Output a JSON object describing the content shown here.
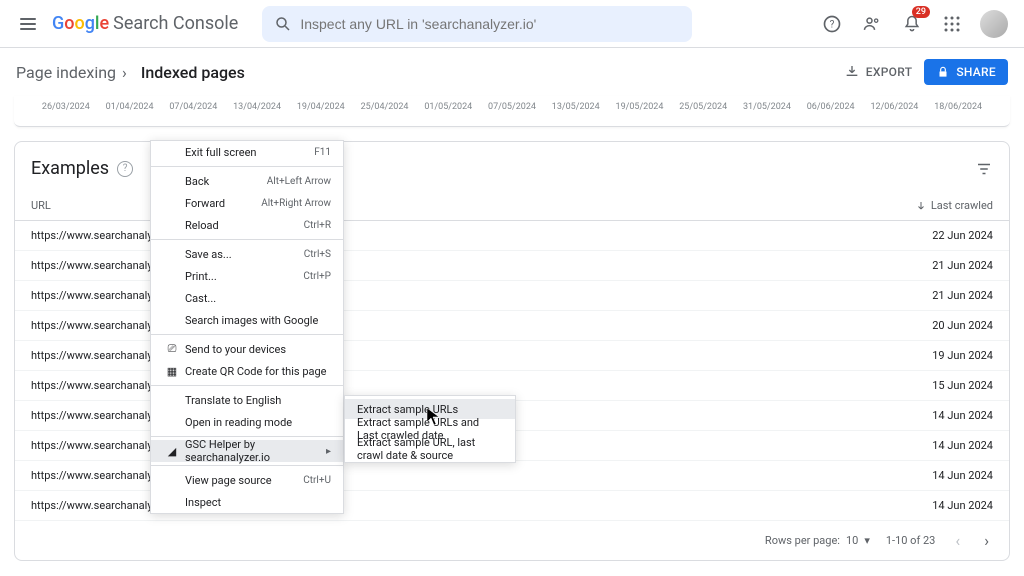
{
  "header": {
    "logo_text": "Search Console",
    "search_placeholder": "Inspect any URL in 'searchanalyzer.io'",
    "notification_count": "29"
  },
  "breadcrumb": {
    "parent": "Page indexing",
    "current": "Indexed pages"
  },
  "actions": {
    "export": "EXPORT",
    "share": "SHARE"
  },
  "dates": [
    "26/03/2024",
    "01/04/2024",
    "07/04/2024",
    "13/04/2024",
    "19/04/2024",
    "25/04/2024",
    "01/05/2024",
    "07/05/2024",
    "13/05/2024",
    "19/05/2024",
    "25/05/2024",
    "31/05/2024",
    "06/06/2024",
    "12/06/2024",
    "18/06/2024"
  ],
  "card": {
    "title": "Examples",
    "col_url": "URL",
    "col_date": "Last crawled"
  },
  "rows": [
    {
      "url": "https://www.searchanalyzer.io/",
      "date": "22 Jun 2024"
    },
    {
      "url": "https://www.searchanalyzer.io/se",
      "date": "21 Jun 2024"
    },
    {
      "url": "https://www.searchanalyzer.io/g",
      "date": "21 Jun 2024"
    },
    {
      "url": "https://www.searchanalyzer.io/w                                                                        ierung-von-seiten",
      "date": "20 Jun 2024"
    },
    {
      "url": "https://www.searchanalyzer.io/fe",
      "date": "19 Jun 2024"
    },
    {
      "url": "https://www.searchanalyzer.io/fe",
      "date": "15 Jun 2024"
    },
    {
      "url": "https://www.searchanalyzer.io/in",
      "date": "14 Jun 2024"
    },
    {
      "url": "https://www.searchanalyzer.io/tu",
      "date": "14 Jun 2024"
    },
    {
      "url": "https://www.searchanalyzer.io/features/content-optimierung",
      "date": "14 Jun 2024"
    },
    {
      "url": "https://www.searchanalyzer.io/features/optimization-wizard",
      "date": "14 Jun 2024"
    }
  ],
  "pagination": {
    "rows_label": "Rows per page:",
    "rows_value": "10",
    "range": "1-10 of 23"
  },
  "context_menu": {
    "items": [
      {
        "label": "Exit full screen",
        "shortcut": "F11"
      },
      {
        "divider": true
      },
      {
        "label": "Back",
        "shortcut": "Alt+Left Arrow"
      },
      {
        "label": "Forward",
        "shortcut": "Alt+Right Arrow"
      },
      {
        "label": "Reload",
        "shortcut": "Ctrl+R"
      },
      {
        "divider": true
      },
      {
        "label": "Save as...",
        "shortcut": "Ctrl+S"
      },
      {
        "label": "Print...",
        "shortcut": "Ctrl+P"
      },
      {
        "label": "Cast..."
      },
      {
        "label": "Search images with Google"
      },
      {
        "divider": true
      },
      {
        "label": "Send to your devices",
        "icon": "devices"
      },
      {
        "label": "Create QR Code for this page",
        "icon": "qr"
      },
      {
        "divider": true
      },
      {
        "label": "Translate to English"
      },
      {
        "label": "Open in reading mode"
      },
      {
        "divider": true
      },
      {
        "label": "GSC Helper by searchanalyzer.io",
        "icon": "ext",
        "submenu": true,
        "highlighted": true
      },
      {
        "divider": true
      },
      {
        "label": "View page source",
        "shortcut": "Ctrl+U"
      },
      {
        "label": "Inspect"
      }
    ]
  },
  "submenu": {
    "items": [
      {
        "label": "Extract sample URLs",
        "highlighted": true
      },
      {
        "label": "Extract sample URLs and Last crawled date"
      },
      {
        "label": "Extract sample URL, last crawl date & source"
      }
    ]
  }
}
